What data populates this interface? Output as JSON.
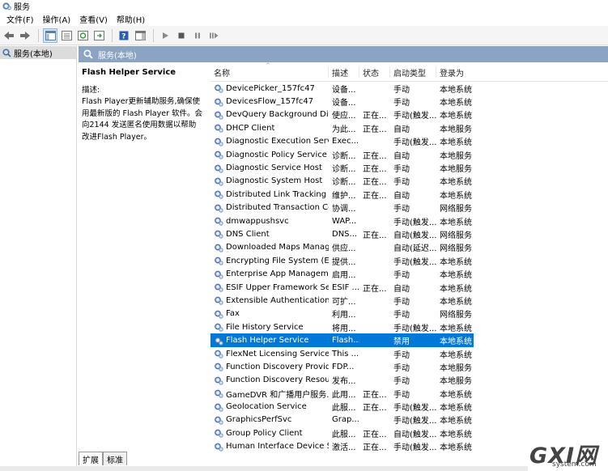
{
  "window": {
    "title": "服务"
  },
  "menu": [
    "文件(F)",
    "操作(A)",
    "查看(V)",
    "帮助(H)"
  ],
  "tree": {
    "root_label": "服务(本地)"
  },
  "panel": {
    "header": "服务(本地)"
  },
  "description": {
    "title": "Flash Helper Service",
    "label": "描述:",
    "text": "Flash Player更新辅助服务,确保使用最新版的 Flash Player 软件。会向2144 发送匿名使用数据以帮助改进Flash Player。"
  },
  "table": {
    "columns": [
      "名称",
      "描述",
      "状态",
      "启动类型",
      "登录为"
    ],
    "rows": [
      {
        "name": "DevicePicker_157fc47",
        "desc": "设备...",
        "status": "",
        "start": "手动",
        "logon": "本地系统"
      },
      {
        "name": "DevicesFlow_157fc47",
        "desc": "设备...",
        "status": "",
        "start": "手动",
        "logon": "本地系统"
      },
      {
        "name": "DevQuery Background Dis...",
        "desc": "使应...",
        "status": "正在...",
        "start": "手动(触发...",
        "logon": "本地系统"
      },
      {
        "name": "DHCP Client",
        "desc": "为此...",
        "status": "正在...",
        "start": "自动",
        "logon": "本地服务"
      },
      {
        "name": "Diagnostic Execution Service",
        "desc": "Exec...",
        "status": "",
        "start": "手动(触发...",
        "logon": "本地系统"
      },
      {
        "name": "Diagnostic Policy Service",
        "desc": "诊断...",
        "status": "正在...",
        "start": "自动",
        "logon": "本地服务"
      },
      {
        "name": "Diagnostic Service Host",
        "desc": "诊断...",
        "status": "正在...",
        "start": "手动",
        "logon": "本地服务"
      },
      {
        "name": "Diagnostic System Host",
        "desc": "诊断...",
        "status": "正在...",
        "start": "手动",
        "logon": "本地系统"
      },
      {
        "name": "Distributed Link Tracking C...",
        "desc": "维护...",
        "status": "正在...",
        "start": "自动",
        "logon": "本地系统"
      },
      {
        "name": "Distributed Transaction Co...",
        "desc": "协调...",
        "status": "",
        "start": "手动",
        "logon": "网络服务"
      },
      {
        "name": "dmwappushsvc",
        "desc": "WAP...",
        "status": "",
        "start": "手动(触发...",
        "logon": "本地系统"
      },
      {
        "name": "DNS Client",
        "desc": "DNS...",
        "status": "正在...",
        "start": "自动(触发...",
        "logon": "网络服务"
      },
      {
        "name": "Downloaded Maps Manager",
        "desc": "供应...",
        "status": "",
        "start": "自动(延迟...",
        "logon": "网络服务"
      },
      {
        "name": "Encrypting File System (EFS)",
        "desc": "提供...",
        "status": "",
        "start": "手动(触发...",
        "logon": "本地系统"
      },
      {
        "name": "Enterprise App Manageme...",
        "desc": "启用...",
        "status": "",
        "start": "手动",
        "logon": "本地系统"
      },
      {
        "name": "ESIF Upper Framework Ser...",
        "desc": "ESIF ...",
        "status": "正在...",
        "start": "自动",
        "logon": "本地系统"
      },
      {
        "name": "Extensible Authentication ...",
        "desc": "可扩...",
        "status": "",
        "start": "手动",
        "logon": "本地系统"
      },
      {
        "name": "Fax",
        "desc": "利用...",
        "status": "",
        "start": "手动",
        "logon": "网络服务"
      },
      {
        "name": "File History Service",
        "desc": "将用...",
        "status": "",
        "start": "手动(触发...",
        "logon": "本地系统"
      },
      {
        "name": "Flash Helper Service",
        "desc": "Flash...",
        "status": "",
        "start": "禁用",
        "logon": "本地系统",
        "selected": true
      },
      {
        "name": "FlexNet Licensing Service",
        "desc": "This ...",
        "status": "",
        "start": "手动",
        "logon": "本地系统"
      },
      {
        "name": "Function Discovery Provide...",
        "desc": "FDP...",
        "status": "",
        "start": "手动",
        "logon": "本地服务"
      },
      {
        "name": "Function Discovery Resour...",
        "desc": "发布...",
        "status": "",
        "start": "手动",
        "logon": "本地服务"
      },
      {
        "name": "GameDVR 和广播用户服务...",
        "desc": "此用...",
        "status": "正在...",
        "start": "手动",
        "logon": "本地系统"
      },
      {
        "name": "Geolocation Service",
        "desc": "此服...",
        "status": "正在...",
        "start": "手动(触发...",
        "logon": "本地系统"
      },
      {
        "name": "GraphicsPerfSvc",
        "desc": "Grap...",
        "status": "",
        "start": "手动(触发...",
        "logon": "本地系统"
      },
      {
        "name": "Group Policy Client",
        "desc": "此服...",
        "status": "正在...",
        "start": "自动(触发...",
        "logon": "本地系统"
      },
      {
        "name": "Human Interface Device S...",
        "desc": "激活...",
        "status": "正在...",
        "start": "手动(触发...",
        "logon": "本地系统"
      }
    ]
  },
  "tabs": [
    "扩展",
    "标准"
  ],
  "watermark": {
    "brand": "GXI网",
    "site": "system.com"
  },
  "colors": {
    "selection": "#0078d7",
    "header": "#8ba4c3"
  }
}
